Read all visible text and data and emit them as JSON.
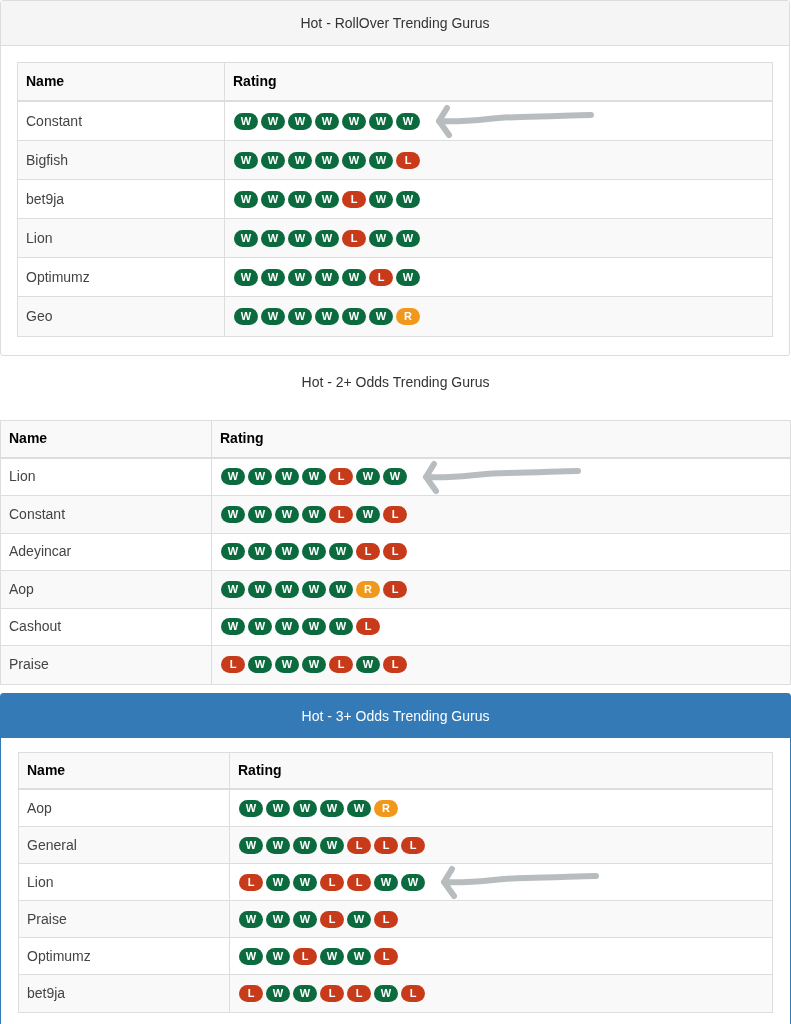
{
  "panels": [
    {
      "kind": "default",
      "title": "Hot - RollOver Trending Gurus",
      "columns": [
        "Name",
        "Rating"
      ],
      "rows": [
        {
          "name": "Constant",
          "marked": true,
          "badges": [
            {
              "label": "W",
              "color": "#0b6b3e"
            },
            {
              "label": "W",
              "color": "#0b6b3e"
            },
            {
              "label": "W",
              "color": "#0b6b3e"
            },
            {
              "label": "W",
              "color": "#0b6b3e"
            },
            {
              "label": "W",
              "color": "#0b6b3e"
            },
            {
              "label": "W",
              "color": "#0b6b3e"
            },
            {
              "label": "W",
              "color": "#0b6b3e"
            }
          ]
        },
        {
          "name": "Bigfish",
          "marked": false,
          "badges": [
            {
              "label": "W",
              "color": "#0b6b3e"
            },
            {
              "label": "W",
              "color": "#0b6b3e"
            },
            {
              "label": "W",
              "color": "#0b6b3e"
            },
            {
              "label": "W",
              "color": "#0b6b3e"
            },
            {
              "label": "W",
              "color": "#0b6b3e"
            },
            {
              "label": "W",
              "color": "#0b6b3e"
            },
            {
              "label": "L",
              "color": "#c73a1a"
            }
          ]
        },
        {
          "name": "bet9ja",
          "marked": false,
          "badges": [
            {
              "label": "W",
              "color": "#0b6b3e"
            },
            {
              "label": "W",
              "color": "#0b6b3e"
            },
            {
              "label": "W",
              "color": "#0b6b3e"
            },
            {
              "label": "W",
              "color": "#0b6b3e"
            },
            {
              "label": "L",
              "color": "#c73a1a"
            },
            {
              "label": "W",
              "color": "#0b6b3e"
            },
            {
              "label": "W",
              "color": "#0b6b3e"
            }
          ]
        },
        {
          "name": "Lion",
          "marked": false,
          "badges": [
            {
              "label": "W",
              "color": "#0b6b3e"
            },
            {
              "label": "W",
              "color": "#0b6b3e"
            },
            {
              "label": "W",
              "color": "#0b6b3e"
            },
            {
              "label": "W",
              "color": "#0b6b3e"
            },
            {
              "label": "L",
              "color": "#c73a1a"
            },
            {
              "label": "W",
              "color": "#0b6b3e"
            },
            {
              "label": "W",
              "color": "#0b6b3e"
            }
          ]
        },
        {
          "name": "Optimumz",
          "marked": false,
          "badges": [
            {
              "label": "W",
              "color": "#0b6b3e"
            },
            {
              "label": "W",
              "color": "#0b6b3e"
            },
            {
              "label": "W",
              "color": "#0b6b3e"
            },
            {
              "label": "W",
              "color": "#0b6b3e"
            },
            {
              "label": "W",
              "color": "#0b6b3e"
            },
            {
              "label": "L",
              "color": "#c73a1a"
            },
            {
              "label": "W",
              "color": "#0b6b3e"
            }
          ]
        },
        {
          "name": "Geo",
          "marked": false,
          "badges": [
            {
              "label": "W",
              "color": "#0b6b3e"
            },
            {
              "label": "W",
              "color": "#0b6b3e"
            },
            {
              "label": "W",
              "color": "#0b6b3e"
            },
            {
              "label": "W",
              "color": "#0b6b3e"
            },
            {
              "label": "W",
              "color": "#0b6b3e"
            },
            {
              "label": "W",
              "color": "#0b6b3e"
            },
            {
              "label": "R",
              "color": "#f0981c"
            }
          ]
        }
      ]
    },
    {
      "kind": "plain",
      "title": "Hot - 2+ Odds Trending Gurus",
      "columns": [
        "Name",
        "Rating"
      ],
      "rows": [
        {
          "name": "Lion",
          "marked": true,
          "badges": [
            {
              "label": "W",
              "color": "#0b6b3e"
            },
            {
              "label": "W",
              "color": "#0b6b3e"
            },
            {
              "label": "W",
              "color": "#0b6b3e"
            },
            {
              "label": "W",
              "color": "#0b6b3e"
            },
            {
              "label": "L",
              "color": "#c73a1a"
            },
            {
              "label": "W",
              "color": "#0b6b3e"
            },
            {
              "label": "W",
              "color": "#0b6b3e"
            }
          ]
        },
        {
          "name": "Constant",
          "marked": false,
          "badges": [
            {
              "label": "W",
              "color": "#0b6b3e"
            },
            {
              "label": "W",
              "color": "#0b6b3e"
            },
            {
              "label": "W",
              "color": "#0b6b3e"
            },
            {
              "label": "W",
              "color": "#0b6b3e"
            },
            {
              "label": "L",
              "color": "#c73a1a"
            },
            {
              "label": "W",
              "color": "#0b6b3e"
            },
            {
              "label": "L",
              "color": "#c73a1a"
            }
          ]
        },
        {
          "name": "Adeyincar",
          "marked": false,
          "badges": [
            {
              "label": "W",
              "color": "#0b6b3e"
            },
            {
              "label": "W",
              "color": "#0b6b3e"
            },
            {
              "label": "W",
              "color": "#0b6b3e"
            },
            {
              "label": "W",
              "color": "#0b6b3e"
            },
            {
              "label": "W",
              "color": "#0b6b3e"
            },
            {
              "label": "L",
              "color": "#c73a1a"
            },
            {
              "label": "L",
              "color": "#c73a1a"
            }
          ]
        },
        {
          "name": "Aop",
          "marked": false,
          "badges": [
            {
              "label": "W",
              "color": "#0b6b3e"
            },
            {
              "label": "W",
              "color": "#0b6b3e"
            },
            {
              "label": "W",
              "color": "#0b6b3e"
            },
            {
              "label": "W",
              "color": "#0b6b3e"
            },
            {
              "label": "W",
              "color": "#0b6b3e"
            },
            {
              "label": "R",
              "color": "#f0981c"
            },
            {
              "label": "L",
              "color": "#c73a1a"
            }
          ]
        },
        {
          "name": "Cashout",
          "marked": false,
          "badges": [
            {
              "label": "W",
              "color": "#0b6b3e"
            },
            {
              "label": "W",
              "color": "#0b6b3e"
            },
            {
              "label": "W",
              "color": "#0b6b3e"
            },
            {
              "label": "W",
              "color": "#0b6b3e"
            },
            {
              "label": "W",
              "color": "#0b6b3e"
            },
            {
              "label": "L",
              "color": "#c73a1a"
            }
          ]
        },
        {
          "name": "Praise",
          "marked": false,
          "badges": [
            {
              "label": "L",
              "color": "#c73a1a"
            },
            {
              "label": "W",
              "color": "#0b6b3e"
            },
            {
              "label": "W",
              "color": "#0b6b3e"
            },
            {
              "label": "W",
              "color": "#0b6b3e"
            },
            {
              "label": "L",
              "color": "#c73a1a"
            },
            {
              "label": "W",
              "color": "#0b6b3e"
            },
            {
              "label": "L",
              "color": "#c73a1a"
            }
          ]
        }
      ]
    },
    {
      "kind": "primary",
      "title": "Hot - 3+ Odds Trending Gurus",
      "columns": [
        "Name",
        "Rating"
      ],
      "rows": [
        {
          "name": "Aop",
          "marked": false,
          "badges": [
            {
              "label": "W",
              "color": "#0b6b3e"
            },
            {
              "label": "W",
              "color": "#0b6b3e"
            },
            {
              "label": "W",
              "color": "#0b6b3e"
            },
            {
              "label": "W",
              "color": "#0b6b3e"
            },
            {
              "label": "W",
              "color": "#0b6b3e"
            },
            {
              "label": "R",
              "color": "#f0981c"
            }
          ]
        },
        {
          "name": "General",
          "marked": false,
          "badges": [
            {
              "label": "W",
              "color": "#0b6b3e"
            },
            {
              "label": "W",
              "color": "#0b6b3e"
            },
            {
              "label": "W",
              "color": "#0b6b3e"
            },
            {
              "label": "W",
              "color": "#0b6b3e"
            },
            {
              "label": "L",
              "color": "#c73a1a"
            },
            {
              "label": "L",
              "color": "#c73a1a"
            },
            {
              "label": "L",
              "color": "#c73a1a"
            }
          ]
        },
        {
          "name": "Lion",
          "marked": true,
          "badges": [
            {
              "label": "L",
              "color": "#c73a1a"
            },
            {
              "label": "W",
              "color": "#0b6b3e"
            },
            {
              "label": "W",
              "color": "#0b6b3e"
            },
            {
              "label": "L",
              "color": "#c73a1a"
            },
            {
              "label": "L",
              "color": "#c73a1a"
            },
            {
              "label": "W",
              "color": "#0b6b3e"
            },
            {
              "label": "W",
              "color": "#0b6b3e"
            }
          ]
        },
        {
          "name": "Praise",
          "marked": false,
          "badges": [
            {
              "label": "W",
              "color": "#0b6b3e"
            },
            {
              "label": "W",
              "color": "#0b6b3e"
            },
            {
              "label": "W",
              "color": "#0b6b3e"
            },
            {
              "label": "L",
              "color": "#c73a1a"
            },
            {
              "label": "W",
              "color": "#0b6b3e"
            },
            {
              "label": "L",
              "color": "#c73a1a"
            }
          ]
        },
        {
          "name": "Optimumz",
          "marked": false,
          "badges": [
            {
              "label": "W",
              "color": "#0b6b3e"
            },
            {
              "label": "W",
              "color": "#0b6b3e"
            },
            {
              "label": "L",
              "color": "#c73a1a"
            },
            {
              "label": "W",
              "color": "#0b6b3e"
            },
            {
              "label": "W",
              "color": "#0b6b3e"
            },
            {
              "label": "L",
              "color": "#c73a1a"
            }
          ]
        },
        {
          "name": "bet9ja",
          "marked": false,
          "badges": [
            {
              "label": "L",
              "color": "#c73a1a"
            },
            {
              "label": "W",
              "color": "#0b6b3e"
            },
            {
              "label": "W",
              "color": "#0b6b3e"
            },
            {
              "label": "L",
              "color": "#c73a1a"
            },
            {
              "label": "L",
              "color": "#c73a1a"
            },
            {
              "label": "W",
              "color": "#0b6b3e"
            },
            {
              "label": "L",
              "color": "#c73a1a"
            }
          ]
        }
      ]
    }
  ]
}
